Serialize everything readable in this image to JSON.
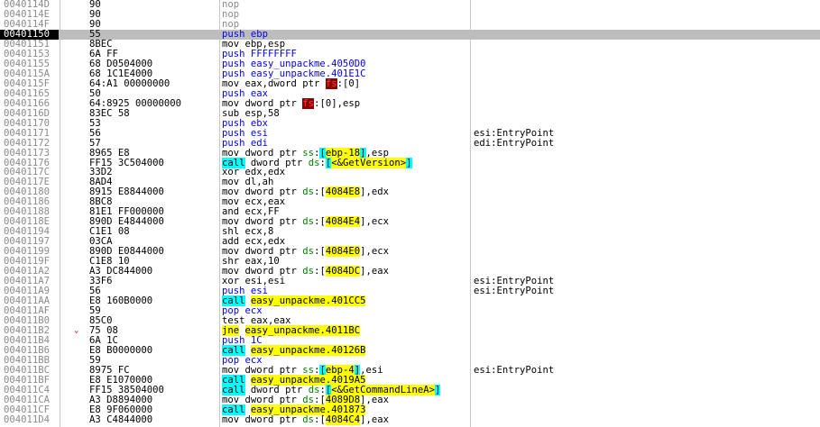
{
  "rows": [
    {
      "addr": "0040114D",
      "bytes": "90",
      "parts": [
        {
          "t": "nop",
          "c": "t-nop"
        }
      ],
      "comment": ""
    },
    {
      "addr": "0040114E",
      "bytes": "90",
      "parts": [
        {
          "t": "nop",
          "c": "t-nop"
        }
      ],
      "comment": ""
    },
    {
      "addr": "0040114F",
      "bytes": "90",
      "parts": [
        {
          "t": "nop",
          "c": "t-nop"
        }
      ],
      "comment": ""
    },
    {
      "addr": "00401150",
      "bytes": "55",
      "parts": [
        {
          "t": "push ebp",
          "c": "b"
        }
      ],
      "comment": "",
      "selected": true
    },
    {
      "addr": "00401151",
      "bytes": "8BEC",
      "parts": [
        {
          "t": "mov ebp,esp",
          "c": "m"
        }
      ],
      "comment": ""
    },
    {
      "addr": "00401153",
      "bytes": "6A FF",
      "parts": [
        {
          "t": "push FFFFFFFF",
          "c": "b"
        }
      ],
      "comment": ""
    },
    {
      "addr": "00401155",
      "bytes": "68 D0504000",
      "parts": [
        {
          "t": "push easy_unpackme.4050D0",
          "c": "b"
        }
      ],
      "comment": ""
    },
    {
      "addr": "0040115A",
      "bytes": "68 1C1E4000",
      "parts": [
        {
          "t": "push easy_unpackme.401E1C",
          "c": "b"
        }
      ],
      "comment": ""
    },
    {
      "addr": "0040115F",
      "bytes": "64:A1 00000000",
      "parts": [
        {
          "t": "mov eax,dword ptr ",
          "c": "m"
        },
        {
          "t": "fs",
          "c": "hl-red"
        },
        {
          "t": ":[0]",
          "c": "m"
        }
      ],
      "comment": ""
    },
    {
      "addr": "00401165",
      "bytes": "50",
      "parts": [
        {
          "t": "push eax",
          "c": "b"
        }
      ],
      "comment": ""
    },
    {
      "addr": "00401166",
      "bytes": "64:8925 00000000",
      "parts": [
        {
          "t": "mov dword ptr ",
          "c": "m"
        },
        {
          "t": "fs",
          "c": "hl-red"
        },
        {
          "t": ":[0],esp",
          "c": "m"
        }
      ],
      "comment": ""
    },
    {
      "addr": "0040116D",
      "bytes": "83EC 58",
      "parts": [
        {
          "t": "sub esp,58",
          "c": "m"
        }
      ],
      "comment": ""
    },
    {
      "addr": "00401170",
      "bytes": "53",
      "parts": [
        {
          "t": "push ebx",
          "c": "b"
        }
      ],
      "comment": ""
    },
    {
      "addr": "00401171",
      "bytes": "56",
      "parts": [
        {
          "t": "push esi",
          "c": "b"
        }
      ],
      "comment": "esi:EntryPoint"
    },
    {
      "addr": "00401172",
      "bytes": "57",
      "parts": [
        {
          "t": "push edi",
          "c": "b"
        }
      ],
      "comment": "edi:EntryPoint"
    },
    {
      "addr": "00401173",
      "bytes": "8965 E8",
      "parts": [
        {
          "t": "mov dword ptr ",
          "c": "m"
        },
        {
          "t": "ss",
          "c": "g"
        },
        {
          "t": ":",
          "c": "m"
        },
        {
          "t": "[",
          "c": "hl-c"
        },
        {
          "t": "ebp-18",
          "c": "hl-y"
        },
        {
          "t": "]",
          "c": "hl-c"
        },
        {
          "t": ",esp",
          "c": "m"
        }
      ],
      "comment": ""
    },
    {
      "addr": "00401176",
      "bytes": "FF15 3C504000",
      "parts": [
        {
          "t": "call",
          "c": "t-call"
        },
        {
          "t": " dword ptr ",
          "c": "m"
        },
        {
          "t": "ds",
          "c": "g"
        },
        {
          "t": ":",
          "c": "m"
        },
        {
          "t": "[",
          "c": "hl-c"
        },
        {
          "t": "<&GetVersion>",
          "c": "hl-y"
        },
        {
          "t": "]",
          "c": "hl-c"
        }
      ],
      "comment": ""
    },
    {
      "addr": "0040117C",
      "bytes": "33D2",
      "parts": [
        {
          "t": "xor edx,edx",
          "c": "m"
        }
      ],
      "comment": ""
    },
    {
      "addr": "0040117E",
      "bytes": "8AD4",
      "parts": [
        {
          "t": "mov dl,ah",
          "c": "m"
        }
      ],
      "comment": ""
    },
    {
      "addr": "00401180",
      "bytes": "8915 E8844000",
      "parts": [
        {
          "t": "mov dword ptr ",
          "c": "m"
        },
        {
          "t": "ds",
          "c": "g"
        },
        {
          "t": ":[",
          "c": "m"
        },
        {
          "t": "4084E8",
          "c": "hl-y"
        },
        {
          "t": "],edx",
          "c": "m"
        }
      ],
      "comment": ""
    },
    {
      "addr": "00401186",
      "bytes": "8BC8",
      "parts": [
        {
          "t": "mov ecx,eax",
          "c": "m"
        }
      ],
      "comment": ""
    },
    {
      "addr": "00401188",
      "bytes": "81E1 FF000000",
      "parts": [
        {
          "t": "and ecx,FF",
          "c": "m"
        }
      ],
      "comment": ""
    },
    {
      "addr": "0040118E",
      "bytes": "890D E4844000",
      "parts": [
        {
          "t": "mov dword ptr ",
          "c": "m"
        },
        {
          "t": "ds",
          "c": "g"
        },
        {
          "t": ":[",
          "c": "m"
        },
        {
          "t": "4084E4",
          "c": "hl-y"
        },
        {
          "t": "],ecx",
          "c": "m"
        }
      ],
      "comment": ""
    },
    {
      "addr": "00401194",
      "bytes": "C1E1 08",
      "parts": [
        {
          "t": "shl ecx,8",
          "c": "m"
        }
      ],
      "comment": ""
    },
    {
      "addr": "00401197",
      "bytes": "03CA",
      "parts": [
        {
          "t": "add ecx,edx",
          "c": "m"
        }
      ],
      "comment": ""
    },
    {
      "addr": "00401199",
      "bytes": "890D E0844000",
      "parts": [
        {
          "t": "mov dword ptr ",
          "c": "m"
        },
        {
          "t": "ds",
          "c": "g"
        },
        {
          "t": ":[",
          "c": "m"
        },
        {
          "t": "4084E0",
          "c": "hl-y"
        },
        {
          "t": "],ecx",
          "c": "m"
        }
      ],
      "comment": ""
    },
    {
      "addr": "0040119F",
      "bytes": "C1E8 10",
      "parts": [
        {
          "t": "shr eax,10",
          "c": "m"
        }
      ],
      "comment": ""
    },
    {
      "addr": "004011A2",
      "bytes": "A3 DC844000",
      "parts": [
        {
          "t": "mov dword ptr ",
          "c": "m"
        },
        {
          "t": "ds",
          "c": "g"
        },
        {
          "t": ":[",
          "c": "m"
        },
        {
          "t": "4084DC",
          "c": "hl-y"
        },
        {
          "t": "],eax",
          "c": "m"
        }
      ],
      "comment": ""
    },
    {
      "addr": "004011A7",
      "bytes": "33F6",
      "parts": [
        {
          "t": "xor esi,esi",
          "c": "m"
        }
      ],
      "comment": "esi:EntryPoint"
    },
    {
      "addr": "004011A9",
      "bytes": "56",
      "parts": [
        {
          "t": "push esi",
          "c": "b"
        }
      ],
      "comment": "esi:EntryPoint"
    },
    {
      "addr": "004011AA",
      "bytes": "E8 160B0000",
      "parts": [
        {
          "t": "call",
          "c": "t-call"
        },
        {
          "t": " ",
          "c": "m"
        },
        {
          "t": "easy_unpackme.401CC5",
          "c": "hl-y"
        }
      ],
      "comment": ""
    },
    {
      "addr": "004011AF",
      "bytes": "59",
      "parts": [
        {
          "t": "pop ecx",
          "c": "b"
        }
      ],
      "comment": ""
    },
    {
      "addr": "004011B0",
      "bytes": "85C0",
      "parts": [
        {
          "t": "test eax,eax",
          "c": "m"
        }
      ],
      "comment": ""
    },
    {
      "addr": "004011B2",
      "bytes": "75 08",
      "parts": [
        {
          "t": "jne",
          "c": "t-jne"
        },
        {
          "t": " ",
          "c": "m"
        },
        {
          "t": "easy_unpackme.4011BC",
          "c": "hl-y"
        }
      ],
      "comment": "",
      "jump": "⌄"
    },
    {
      "addr": "004011B4",
      "bytes": "6A 1C",
      "parts": [
        {
          "t": "push 1C",
          "c": "b"
        }
      ],
      "comment": ""
    },
    {
      "addr": "004011B6",
      "bytes": "E8 B0000000",
      "parts": [
        {
          "t": "call",
          "c": "t-call"
        },
        {
          "t": " ",
          "c": "m"
        },
        {
          "t": "easy_unpackme.40126B",
          "c": "hl-y"
        }
      ],
      "comment": ""
    },
    {
      "addr": "004011BB",
      "bytes": "59",
      "parts": [
        {
          "t": "pop ecx",
          "c": "b"
        }
      ],
      "comment": ""
    },
    {
      "addr": "004011BC",
      "bytes": "8975 FC",
      "parts": [
        {
          "t": "mov dword ptr ",
          "c": "m"
        },
        {
          "t": "ss",
          "c": "g"
        },
        {
          "t": ":",
          "c": "m"
        },
        {
          "t": "[",
          "c": "hl-c"
        },
        {
          "t": "ebp-4",
          "c": "hl-y"
        },
        {
          "t": "]",
          "c": "hl-c"
        },
        {
          "t": ",esi",
          "c": "m"
        }
      ],
      "comment": "esi:EntryPoint"
    },
    {
      "addr": "004011BF",
      "bytes": "E8 E1070000",
      "parts": [
        {
          "t": "call",
          "c": "t-call"
        },
        {
          "t": " ",
          "c": "m"
        },
        {
          "t": "easy_unpackme.4019A5",
          "c": "hl-y"
        }
      ],
      "comment": ""
    },
    {
      "addr": "004011C4",
      "bytes": "FF15 38504000",
      "parts": [
        {
          "t": "call",
          "c": "t-call"
        },
        {
          "t": " dword ptr ",
          "c": "m"
        },
        {
          "t": "ds",
          "c": "g"
        },
        {
          "t": ":",
          "c": "m"
        },
        {
          "t": "[",
          "c": "hl-c"
        },
        {
          "t": "<&GetCommandLineA>",
          "c": "hl-y"
        },
        {
          "t": "]",
          "c": "hl-c"
        }
      ],
      "comment": ""
    },
    {
      "addr": "004011CA",
      "bytes": "A3 D8894000",
      "parts": [
        {
          "t": "mov dword ptr ",
          "c": "m"
        },
        {
          "t": "ds",
          "c": "g"
        },
        {
          "t": ":[",
          "c": "m"
        },
        {
          "t": "4089D8",
          "c": "hl-y"
        },
        {
          "t": "],eax",
          "c": "m"
        }
      ],
      "comment": ""
    },
    {
      "addr": "004011CF",
      "bytes": "E8 9F060000",
      "parts": [
        {
          "t": "call",
          "c": "t-call"
        },
        {
          "t": " ",
          "c": "m"
        },
        {
          "t": "easy_unpackme.401873",
          "c": "hl-y"
        }
      ],
      "comment": ""
    },
    {
      "addr": "004011D4",
      "bytes": "A3 C4844000",
      "parts": [
        {
          "t": "mov dword ptr ",
          "c": "m"
        },
        {
          "t": "ds",
          "c": "g"
        },
        {
          "t": ":[",
          "c": "m"
        },
        {
          "t": "4084C4",
          "c": "hl-y"
        },
        {
          "t": "],eax",
          "c": "m"
        }
      ],
      "comment": ""
    }
  ]
}
